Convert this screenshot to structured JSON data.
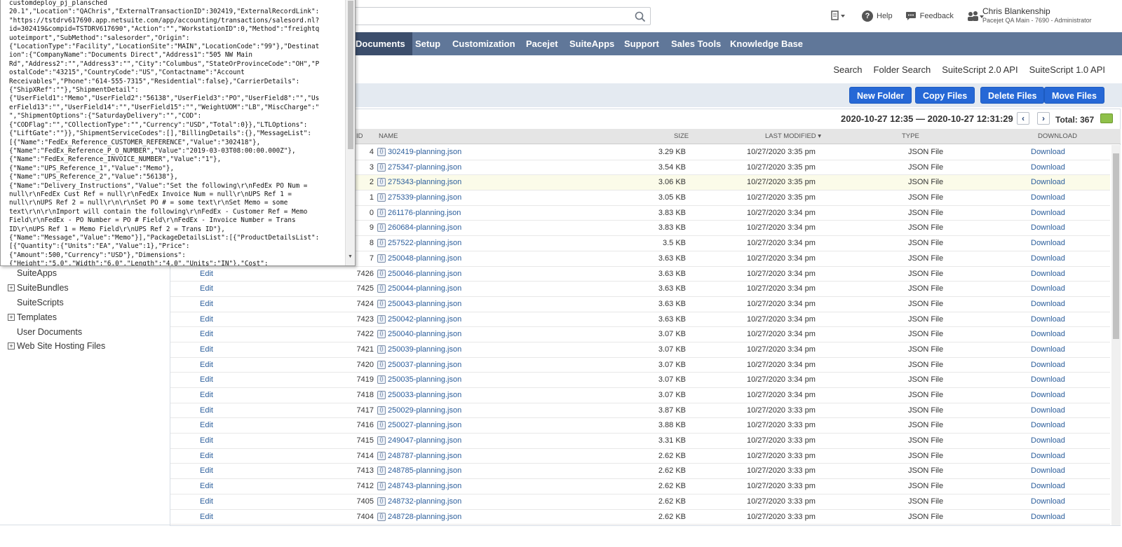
{
  "header": {
    "search_placeholder": "",
    "help_label": "Help",
    "feedback_label": "Feedback",
    "user_name": "Chris Blankenship",
    "user_role": "Pacejet QA Main - 7690 - Administrator"
  },
  "nav": {
    "items": [
      "Documents",
      "Setup",
      "Customization",
      "Pacejet",
      "SuiteApps",
      "Support",
      "Sales Tools",
      "Knowledge Base"
    ]
  },
  "sublinks": [
    "Search",
    "Folder Search",
    "SuiteScript 2.0 API",
    "SuiteScript 1.0 API"
  ],
  "buttons": {
    "new_folder": "New Folder",
    "copy_files": "Copy Files",
    "delete_files": "Delete Files",
    "move_files": "Move Files"
  },
  "pager": {
    "range": "2020-10-27 12:35 — 2020-10-27 12:31:29",
    "prev": "‹",
    "next": "›",
    "total": "Total: 367"
  },
  "table": {
    "columns": {
      "id": "ID",
      "name": "NAME",
      "size": "SIZE",
      "modified": "LAST MODIFIED ▾",
      "type": "TYPE",
      "download": "DOWNLOAD"
    },
    "rows": [
      {
        "edit": "",
        "id": "4",
        "name": "302419-planning.json",
        "size": "3.29 KB",
        "modified": "10/27/2020 3:35 pm",
        "type": "JSON File",
        "download": "Download"
      },
      {
        "edit": "",
        "id": "3",
        "name": "275347-planning.json",
        "size": "3.54 KB",
        "modified": "10/27/2020 3:35 pm",
        "type": "JSON File",
        "download": "Download"
      },
      {
        "edit": "",
        "id": "2",
        "name": "275343-planning.json",
        "size": "3.06 KB",
        "modified": "10/27/2020 3:35 pm",
        "type": "JSON File",
        "download": "Download"
      },
      {
        "edit": "",
        "id": "1",
        "name": "275339-planning.json",
        "size": "3.05 KB",
        "modified": "10/27/2020 3:35 pm",
        "type": "JSON File",
        "download": "Download"
      },
      {
        "edit": "",
        "id": "0",
        "name": "261176-planning.json",
        "size": "3.83 KB",
        "modified": "10/27/2020 3:34 pm",
        "type": "JSON File",
        "download": "Download"
      },
      {
        "edit": "",
        "id": "9",
        "name": "260684-planning.json",
        "size": "3.83 KB",
        "modified": "10/27/2020 3:34 pm",
        "type": "JSON File",
        "download": "Download"
      },
      {
        "edit": "",
        "id": "8",
        "name": "257522-planning.json",
        "size": "3.5 KB",
        "modified": "10/27/2020 3:34 pm",
        "type": "JSON File",
        "download": "Download"
      },
      {
        "edit": "",
        "id": "7",
        "name": "250048-planning.json",
        "size": "3.63 KB",
        "modified": "10/27/2020 3:34 pm",
        "type": "JSON File",
        "download": "Download"
      },
      {
        "edit": "Edit",
        "id": "7426",
        "name": "250046-planning.json",
        "size": "3.63 KB",
        "modified": "10/27/2020 3:34 pm",
        "type": "JSON File",
        "download": "Download"
      },
      {
        "edit": "Edit",
        "id": "7425",
        "name": "250044-planning.json",
        "size": "3.63 KB",
        "modified": "10/27/2020 3:34 pm",
        "type": "JSON File",
        "download": "Download"
      },
      {
        "edit": "Edit",
        "id": "7424",
        "name": "250043-planning.json",
        "size": "3.63 KB",
        "modified": "10/27/2020 3:34 pm",
        "type": "JSON File",
        "download": "Download"
      },
      {
        "edit": "Edit",
        "id": "7423",
        "name": "250042-planning.json",
        "size": "3.63 KB",
        "modified": "10/27/2020 3:34 pm",
        "type": "JSON File",
        "download": "Download"
      },
      {
        "edit": "Edit",
        "id": "7422",
        "name": "250040-planning.json",
        "size": "3.07 KB",
        "modified": "10/27/2020 3:34 pm",
        "type": "JSON File",
        "download": "Download"
      },
      {
        "edit": "Edit",
        "id": "7421",
        "name": "250039-planning.json",
        "size": "3.07 KB",
        "modified": "10/27/2020 3:34 pm",
        "type": "JSON File",
        "download": "Download"
      },
      {
        "edit": "Edit",
        "id": "7420",
        "name": "250037-planning.json",
        "size": "3.07 KB",
        "modified": "10/27/2020 3:34 pm",
        "type": "JSON File",
        "download": "Download"
      },
      {
        "edit": "Edit",
        "id": "7419",
        "name": "250035-planning.json",
        "size": "3.07 KB",
        "modified": "10/27/2020 3:34 pm",
        "type": "JSON File",
        "download": "Download"
      },
      {
        "edit": "Edit",
        "id": "7418",
        "name": "250033-planning.json",
        "size": "3.07 KB",
        "modified": "10/27/2020 3:34 pm",
        "type": "JSON File",
        "download": "Download"
      },
      {
        "edit": "Edit",
        "id": "7417",
        "name": "250029-planning.json",
        "size": "3.87 KB",
        "modified": "10/27/2020 3:33 pm",
        "type": "JSON File",
        "download": "Download"
      },
      {
        "edit": "Edit",
        "id": "7416",
        "name": "250027-planning.json",
        "size": "3.88 KB",
        "modified": "10/27/2020 3:33 pm",
        "type": "JSON File",
        "download": "Download"
      },
      {
        "edit": "Edit",
        "id": "7415",
        "name": "249047-planning.json",
        "size": "3.31 KB",
        "modified": "10/27/2020 3:33 pm",
        "type": "JSON File",
        "download": "Download"
      },
      {
        "edit": "Edit",
        "id": "7414",
        "name": "248787-planning.json",
        "size": "2.62 KB",
        "modified": "10/27/2020 3:33 pm",
        "type": "JSON File",
        "download": "Download"
      },
      {
        "edit": "Edit",
        "id": "7413",
        "name": "248785-planning.json",
        "size": "2.62 KB",
        "modified": "10/27/2020 3:33 pm",
        "type": "JSON File",
        "download": "Download"
      },
      {
        "edit": "Edit",
        "id": "7412",
        "name": "248743-planning.json",
        "size": "2.62 KB",
        "modified": "10/27/2020 3:33 pm",
        "type": "JSON File",
        "download": "Download"
      },
      {
        "edit": "Edit",
        "id": "7405",
        "name": "248732-planning.json",
        "size": "2.62 KB",
        "modified": "10/27/2020 3:33 pm",
        "type": "JSON File",
        "download": "Download"
      },
      {
        "edit": "Edit",
        "id": "7404",
        "name": "248728-planning.json",
        "size": "2.62 KB",
        "modified": "10/27/2020 3:33 pm",
        "type": "JSON File",
        "download": "Download"
      }
    ]
  },
  "sidebar": {
    "items": [
      {
        "label": "SuiteApps",
        "expandable": false
      },
      {
        "label": "SuiteBundles",
        "expandable": true
      },
      {
        "label": "SuiteScripts",
        "expandable": false
      },
      {
        "label": "Templates",
        "expandable": true
      },
      {
        "label": "User Documents",
        "expandable": false
      },
      {
        "label": "Web Site Hosting Files",
        "expandable": true
      }
    ]
  },
  "popup": {
    "text": "customdeploy_pj_plansched\n20.1\",\"Location\":\"QAChris\",\"ExternalTransactionID\":302419,\"ExternalRecordLink\":\n\"https://tstdrv617690.app.netsuite.com/app/accounting/transactions/salesord.nl?\nid=302419&compid=TSTDRV617690\",\"Action\":\"\",\"WorkstationID\":0,\"Method\":\"freightq\nuoteimport\",\"SubMethod\":\"salesorder\",\"Origin\":\n{\"LocationType\":\"Facility\",\"LocationSite\":\"MAIN\",\"LocationCode\":\"99\"},\"Destinat\nion\":{\"CompanyName\":\"Documents Direct\",\"Address1\":\"505 NW Main\nRd\",\"Address2\":\"\",\"Address3\":\"\",\"City\":\"Columbus\",\"StateOrProvinceCode\":\"OH\",\"P\nostalCode\":\"43215\",\"CountryCode\":\"US\",\"Contactname\":\"Account\nReceivables\",\"Phone\":\"614-555-7315\",\"Residential\":false},\"CarrierDetails\":\n{\"ShipXRef\":\"\"},\"ShipmentDetail\":\n{\"UserField1\":\"Memo\",\"UserField2\":\"56138\",\"UserField3\":\"PO\",\"UserField8\":\"\",\"Us\nerField13\":\"\",\"UserField14\":\"\",\"UserField15\":\"\",\"WeightUOM\":\"LB\",\"MiscCharge\":\"\n\",\"ShipmentOptions\":{\"SaturdayDelivery\":\"\",\"COD\":\n{\"CODFlag\":\"\",\"COllectionType\":\"\",\"Currency\":\"USD\",\"Total\":0}},\"LTLOptions\":\n{\"LiftGate\":\"\"}},\"ShipmentServiceCodes\":[],\"BillingDetails\":{},\"MessageList\":\n[{\"Name\":\"FedEx_Reference_CUSTOMER_REFERENCE\",\"Value\":\"302418\"},\n{\"Name\":\"FedEx_Reference_P_O_NUMBER\",\"Value\":\"2019-03-03T08:00:00.000Z\"},\n{\"Name\":\"FedEx_Reference_INVOICE_NUMBER\",\"Value\":\"1\"},\n{\"Name\":\"UPS_Reference_1\",\"Value\":\"Memo\"},\n{\"Name\":\"UPS_Reference_2\",\"Value\":\"56138\"},\n{\"Name\":\"Delivery_Instructions\",\"Value\":\"Set the following\\r\\nFedEx PO Num =\nnull\\r\\nFedEx Cust Ref = null\\r\\nFedEx Invoice Num = null\\r\\nUPS Ref 1 =\nnull\\r\\nUPS Ref 2 = null\\r\\n\\r\\nSet PO # = some text\\r\\nSet Memo = some\ntext\\r\\n\\r\\nImport will contain the following\\r\\nFedEx - Customer Ref = Memo\nField\\r\\nFedEx - PO Number = PO # Field\\r\\nFedEx - Invoice Number = Trans\nID\\r\\nUPS Ref 1 = Memo Field\\r\\nUPS Ref 2 = Trans ID\"},\n{\"Name\":\"Message\",\"Value\":\"Memo\"}],\"PackageDetailsList\":[{\"ProductDetailsList\":\n[{\"Quantity\":{\"Units\":\"EA\",\"Value\":1},\"Price\":\n{\"Amount\":500,\"Currency\":\"USD\"},\"Dimensions\":\n{\"Height\":\"5.0\",\"Width\":\"6.0\",\"Length\":\"4.0\",\"Units\":\"IN\"},\"Cost\":"
  }
}
